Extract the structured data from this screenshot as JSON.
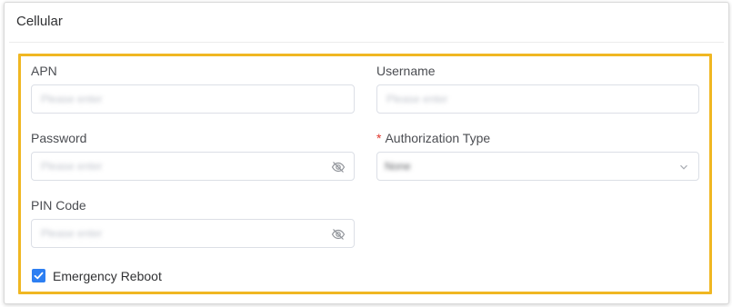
{
  "card": {
    "title": "Cellular"
  },
  "fields": {
    "apn": {
      "label": "APN",
      "placeholder": "Please enter"
    },
    "username": {
      "label": "Username",
      "placeholder": "Please enter"
    },
    "password": {
      "label": "Password",
      "placeholder": "Please enter",
      "icon": "eye-off-icon"
    },
    "authorization_type": {
      "required_mark": "*",
      "label": "Authorization Type",
      "value": "None",
      "icon": "chevron-down-icon"
    },
    "pin_code": {
      "label": "PIN Code",
      "placeholder": "Please enter",
      "icon": "eye-off-icon"
    }
  },
  "emergency_reboot": {
    "label": "Emergency Reboot",
    "checked": true
  },
  "colors": {
    "highlight": "#f0b722",
    "checkbox": "#2d7ff2",
    "required": "#e0352b"
  }
}
